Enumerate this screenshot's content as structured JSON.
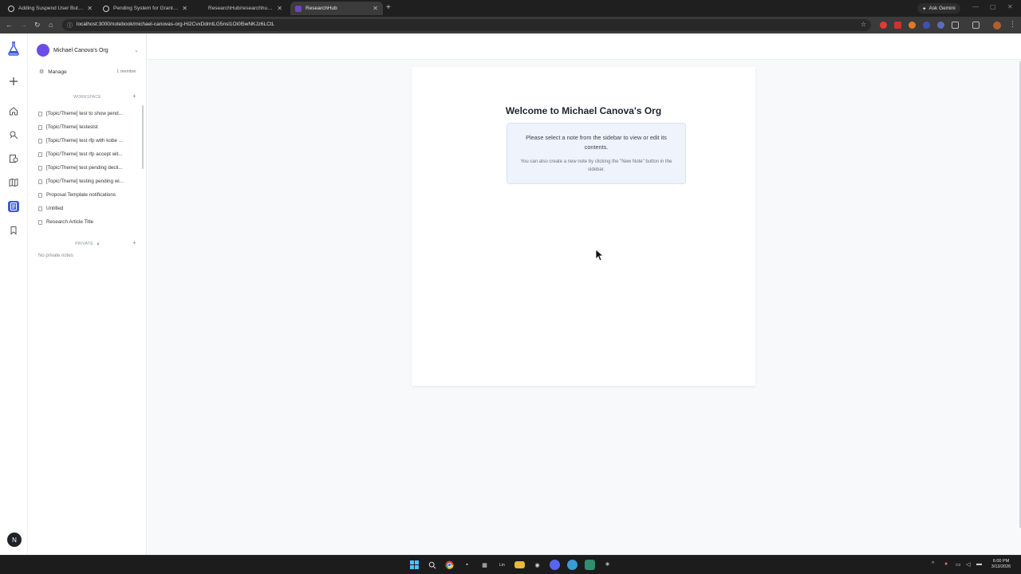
{
  "browser": {
    "tabs": [
      {
        "title": "Adding Suspend User Button to",
        "active": false
      },
      {
        "title": "Pending System for Grants by",
        "active": false
      },
      {
        "title": "ResearchHub/researchhub-bac",
        "active": false
      },
      {
        "title": "ResearchHub",
        "active": true
      }
    ],
    "new_tab": "+",
    "gemini_label": "Ask Gemini",
    "url": "localhost:3000/notebook/michael-canovas-org-Hi2CvxDdmtLG5nsl1Oi0l5wNKJz6LCtL"
  },
  "rail": {
    "icons": [
      "beaker-logo-icon",
      "plus-icon",
      "home-icon",
      "researcher-icon",
      "funding-icon",
      "journal-icon",
      "notebook-icon",
      "bookmark-icon"
    ],
    "active": "notebook-icon",
    "user_initial": "N"
  },
  "sidebar": {
    "org_name": "Michael Canova's Org",
    "manage_label": "Manage",
    "member_count": "1 member",
    "workspace_heading": "WORKSPACE",
    "notes": [
      "[Topic/Theme] test to show pend...",
      "[Topic/Theme] testestst",
      "[Topic/Theme] test rfp with kobe ...",
      "[Topic/Theme] test rfp accept wit...",
      "[Topic/Theme] test pending decli...",
      "[Topic/Theme] testing pending wi...",
      "Proposal Template notifications",
      "Untitled",
      "Research Article Title"
    ],
    "private_heading": "PRIVATE",
    "private_empty": "No private notes"
  },
  "main": {
    "welcome_title": "Welcome to Michael Canova's Org",
    "info_primary": "Please select a note from the sidebar to view or edit its contents.",
    "info_secondary": "You can also create a new note by clicking the \"New Note\" button in the sidebar."
  },
  "taskbar": {
    "time": "6:00 PM",
    "date": "3/13/2026"
  },
  "colors": {
    "accent": "#3b5bdb",
    "org_avatar": "#6d4de8",
    "info_bg": "#eef3fc"
  }
}
